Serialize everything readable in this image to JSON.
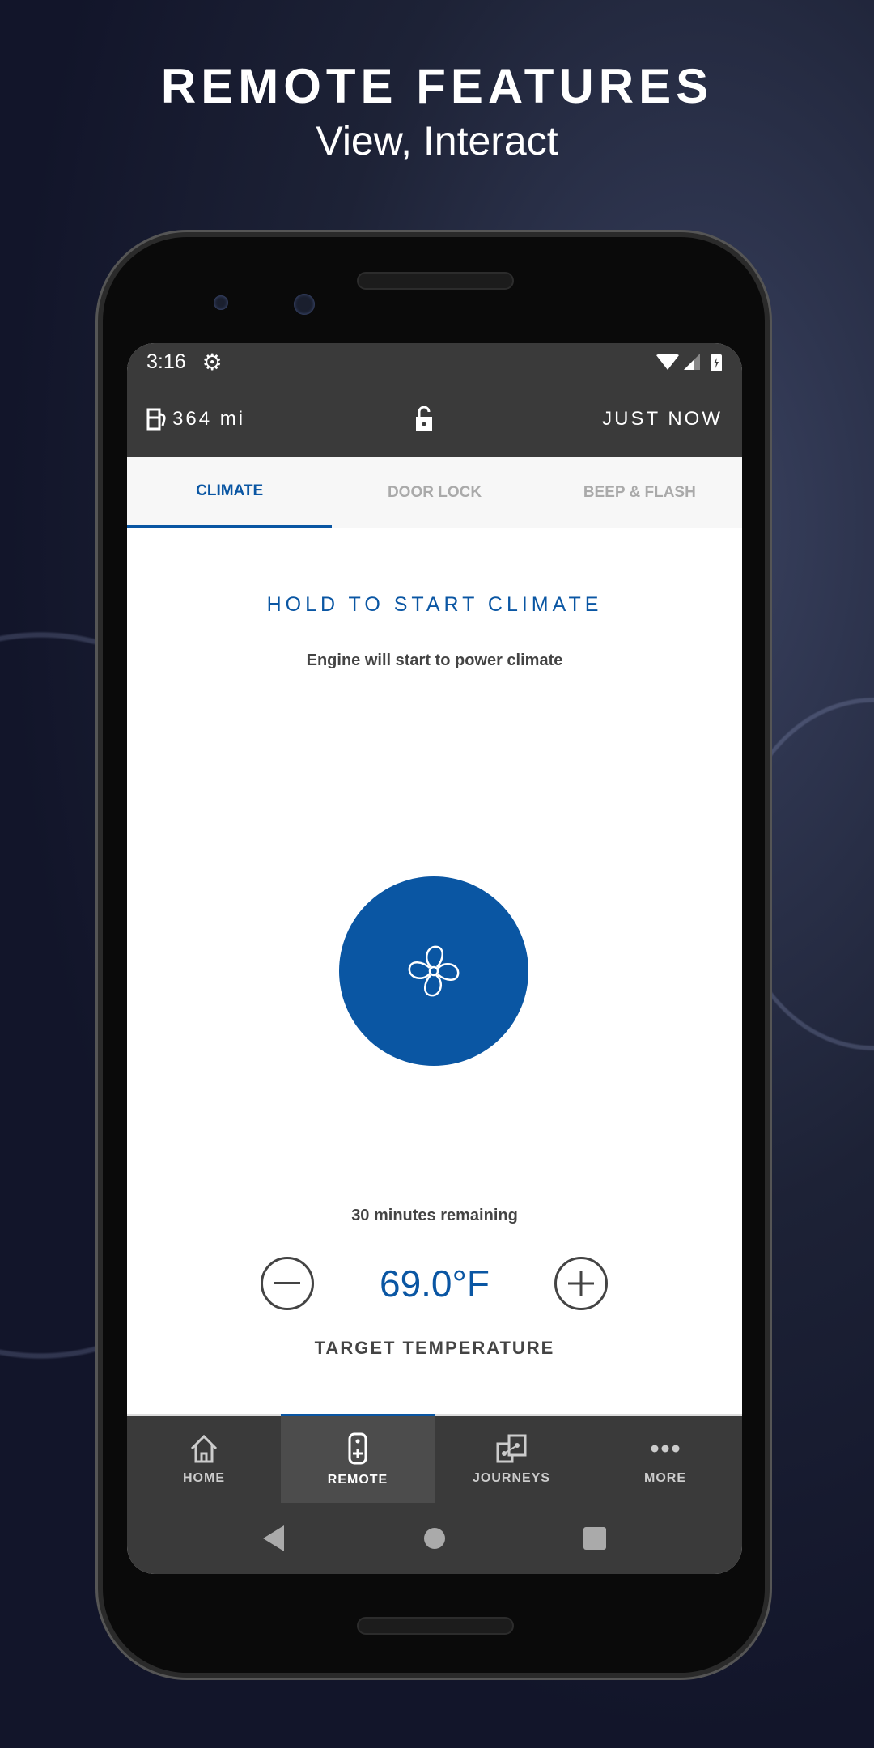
{
  "hero": {
    "title": "REMOTE FEATURES",
    "subtitle": "View, Interact"
  },
  "status_bar": {
    "time": "3:16"
  },
  "header": {
    "range": "364 mi",
    "updated": "JUST NOW"
  },
  "tabs": [
    {
      "label": "CLIMATE",
      "active": true
    },
    {
      "label": "DOOR LOCK"
    },
    {
      "label": "BEEP & FLASH"
    }
  ],
  "climate": {
    "hold_label": "HOLD TO START CLIMATE",
    "note": "Engine will start to power climate",
    "remaining": "30 minutes remaining",
    "temperature": "69.0°F",
    "temperature_label": "TARGET TEMPERATURE"
  },
  "nav": [
    {
      "label": "HOME",
      "icon": "home-icon"
    },
    {
      "label": "REMOTE",
      "icon": "remote-icon",
      "active": true
    },
    {
      "label": "JOURNEYS",
      "icon": "journeys-icon"
    },
    {
      "label": "MORE",
      "icon": "more-icon"
    }
  ],
  "colors": {
    "accent": "#0a56a3",
    "bar": "#3a3a3a"
  }
}
